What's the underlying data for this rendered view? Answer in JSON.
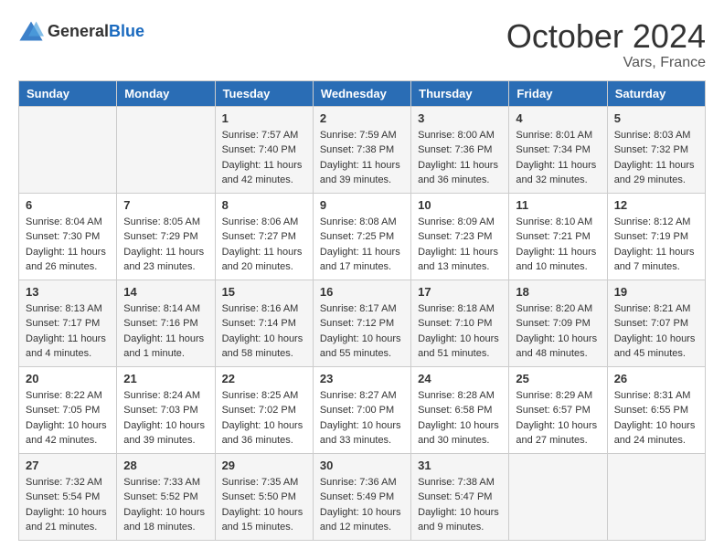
{
  "header": {
    "logo": {
      "general": "General",
      "blue": "Blue"
    },
    "month": "October 2024",
    "location": "Vars, France"
  },
  "weekdays": [
    "Sunday",
    "Monday",
    "Tuesday",
    "Wednesday",
    "Thursday",
    "Friday",
    "Saturday"
  ],
  "weeks": [
    [
      {
        "day": "",
        "sunrise": "",
        "sunset": "",
        "daylight": ""
      },
      {
        "day": "",
        "sunrise": "",
        "sunset": "",
        "daylight": ""
      },
      {
        "day": "1",
        "sunrise": "Sunrise: 7:57 AM",
        "sunset": "Sunset: 7:40 PM",
        "daylight": "Daylight: 11 hours and 42 minutes."
      },
      {
        "day": "2",
        "sunrise": "Sunrise: 7:59 AM",
        "sunset": "Sunset: 7:38 PM",
        "daylight": "Daylight: 11 hours and 39 minutes."
      },
      {
        "day": "3",
        "sunrise": "Sunrise: 8:00 AM",
        "sunset": "Sunset: 7:36 PM",
        "daylight": "Daylight: 11 hours and 36 minutes."
      },
      {
        "day": "4",
        "sunrise": "Sunrise: 8:01 AM",
        "sunset": "Sunset: 7:34 PM",
        "daylight": "Daylight: 11 hours and 32 minutes."
      },
      {
        "day": "5",
        "sunrise": "Sunrise: 8:03 AM",
        "sunset": "Sunset: 7:32 PM",
        "daylight": "Daylight: 11 hours and 29 minutes."
      }
    ],
    [
      {
        "day": "6",
        "sunrise": "Sunrise: 8:04 AM",
        "sunset": "Sunset: 7:30 PM",
        "daylight": "Daylight: 11 hours and 26 minutes."
      },
      {
        "day": "7",
        "sunrise": "Sunrise: 8:05 AM",
        "sunset": "Sunset: 7:29 PM",
        "daylight": "Daylight: 11 hours and 23 minutes."
      },
      {
        "day": "8",
        "sunrise": "Sunrise: 8:06 AM",
        "sunset": "Sunset: 7:27 PM",
        "daylight": "Daylight: 11 hours and 20 minutes."
      },
      {
        "day": "9",
        "sunrise": "Sunrise: 8:08 AM",
        "sunset": "Sunset: 7:25 PM",
        "daylight": "Daylight: 11 hours and 17 minutes."
      },
      {
        "day": "10",
        "sunrise": "Sunrise: 8:09 AM",
        "sunset": "Sunset: 7:23 PM",
        "daylight": "Daylight: 11 hours and 13 minutes."
      },
      {
        "day": "11",
        "sunrise": "Sunrise: 8:10 AM",
        "sunset": "Sunset: 7:21 PM",
        "daylight": "Daylight: 11 hours and 10 minutes."
      },
      {
        "day": "12",
        "sunrise": "Sunrise: 8:12 AM",
        "sunset": "Sunset: 7:19 PM",
        "daylight": "Daylight: 11 hours and 7 minutes."
      }
    ],
    [
      {
        "day": "13",
        "sunrise": "Sunrise: 8:13 AM",
        "sunset": "Sunset: 7:17 PM",
        "daylight": "Daylight: 11 hours and 4 minutes."
      },
      {
        "day": "14",
        "sunrise": "Sunrise: 8:14 AM",
        "sunset": "Sunset: 7:16 PM",
        "daylight": "Daylight: 11 hours and 1 minute."
      },
      {
        "day": "15",
        "sunrise": "Sunrise: 8:16 AM",
        "sunset": "Sunset: 7:14 PM",
        "daylight": "Daylight: 10 hours and 58 minutes."
      },
      {
        "day": "16",
        "sunrise": "Sunrise: 8:17 AM",
        "sunset": "Sunset: 7:12 PM",
        "daylight": "Daylight: 10 hours and 55 minutes."
      },
      {
        "day": "17",
        "sunrise": "Sunrise: 8:18 AM",
        "sunset": "Sunset: 7:10 PM",
        "daylight": "Daylight: 10 hours and 51 minutes."
      },
      {
        "day": "18",
        "sunrise": "Sunrise: 8:20 AM",
        "sunset": "Sunset: 7:09 PM",
        "daylight": "Daylight: 10 hours and 48 minutes."
      },
      {
        "day": "19",
        "sunrise": "Sunrise: 8:21 AM",
        "sunset": "Sunset: 7:07 PM",
        "daylight": "Daylight: 10 hours and 45 minutes."
      }
    ],
    [
      {
        "day": "20",
        "sunrise": "Sunrise: 8:22 AM",
        "sunset": "Sunset: 7:05 PM",
        "daylight": "Daylight: 10 hours and 42 minutes."
      },
      {
        "day": "21",
        "sunrise": "Sunrise: 8:24 AM",
        "sunset": "Sunset: 7:03 PM",
        "daylight": "Daylight: 10 hours and 39 minutes."
      },
      {
        "day": "22",
        "sunrise": "Sunrise: 8:25 AM",
        "sunset": "Sunset: 7:02 PM",
        "daylight": "Daylight: 10 hours and 36 minutes."
      },
      {
        "day": "23",
        "sunrise": "Sunrise: 8:27 AM",
        "sunset": "Sunset: 7:00 PM",
        "daylight": "Daylight: 10 hours and 33 minutes."
      },
      {
        "day": "24",
        "sunrise": "Sunrise: 8:28 AM",
        "sunset": "Sunset: 6:58 PM",
        "daylight": "Daylight: 10 hours and 30 minutes."
      },
      {
        "day": "25",
        "sunrise": "Sunrise: 8:29 AM",
        "sunset": "Sunset: 6:57 PM",
        "daylight": "Daylight: 10 hours and 27 minutes."
      },
      {
        "day": "26",
        "sunrise": "Sunrise: 8:31 AM",
        "sunset": "Sunset: 6:55 PM",
        "daylight": "Daylight: 10 hours and 24 minutes."
      }
    ],
    [
      {
        "day": "27",
        "sunrise": "Sunrise: 7:32 AM",
        "sunset": "Sunset: 5:54 PM",
        "daylight": "Daylight: 10 hours and 21 minutes."
      },
      {
        "day": "28",
        "sunrise": "Sunrise: 7:33 AM",
        "sunset": "Sunset: 5:52 PM",
        "daylight": "Daylight: 10 hours and 18 minutes."
      },
      {
        "day": "29",
        "sunrise": "Sunrise: 7:35 AM",
        "sunset": "Sunset: 5:50 PM",
        "daylight": "Daylight: 10 hours and 15 minutes."
      },
      {
        "day": "30",
        "sunrise": "Sunrise: 7:36 AM",
        "sunset": "Sunset: 5:49 PM",
        "daylight": "Daylight: 10 hours and 12 minutes."
      },
      {
        "day": "31",
        "sunrise": "Sunrise: 7:38 AM",
        "sunset": "Sunset: 5:47 PM",
        "daylight": "Daylight: 10 hours and 9 minutes."
      },
      {
        "day": "",
        "sunrise": "",
        "sunset": "",
        "daylight": ""
      },
      {
        "day": "",
        "sunrise": "",
        "sunset": "",
        "daylight": ""
      }
    ]
  ]
}
